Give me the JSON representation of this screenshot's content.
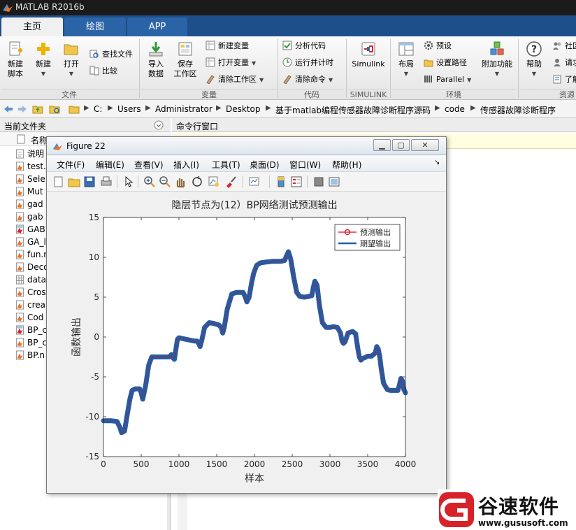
{
  "window": {
    "title": "MATLAB R2016b"
  },
  "ribbon": {
    "tabs": [
      {
        "label": "主页"
      },
      {
        "label": "绘图"
      },
      {
        "label": "APP"
      }
    ],
    "file": {
      "new_script": "新建\n脚本",
      "new": "新建",
      "open": "打开",
      "find_files": "查找文件",
      "compare": "比较",
      "group": "文件"
    },
    "variable": {
      "import_data": "导入\n数据",
      "save_workspace": "保存\n工作区",
      "new_variable": "新建变量",
      "open_variable": "打开变量",
      "clear_workspace": "清除工作区",
      "group": "变量"
    },
    "code": {
      "analyze_code": "分析代码",
      "run_and_time": "运行并计时",
      "clear_commands": "清除命令",
      "group": "代码"
    },
    "simulink": {
      "simulink": "Simulink",
      "group": "SIMULINK"
    },
    "environment": {
      "layout": "布局",
      "preferences": "预设",
      "set_path": "设置路径",
      "parallel": "Parallel",
      "add_ons": "附加功能",
      "group": "环境"
    },
    "resources": {
      "help": "帮助",
      "community": "社区",
      "request_support": "请求",
      "learn": "了解",
      "group": "资源"
    }
  },
  "address": {
    "crumbs": [
      "C:",
      "Users",
      "Administrator",
      "Desktop",
      "基于matlab编程传感器故障诊断程序源码",
      "code",
      "传感器故障诊断程序"
    ]
  },
  "current_folder": {
    "title": "当前文件夹",
    "col_name": "名称",
    "files": [
      {
        "name": "说明",
        "icon": "text-file-icon"
      },
      {
        "name": "test.",
        "icon": "m-file-icon"
      },
      {
        "name": "Sele",
        "icon": "m-file-icon"
      },
      {
        "name": "Mut",
        "icon": "m-file-icon"
      },
      {
        "name": "gad",
        "icon": "m-file-icon"
      },
      {
        "name": "gab",
        "icon": "m-file-icon"
      },
      {
        "name": "GAB",
        "icon": "fig-file-icon"
      },
      {
        "name": "GA_l",
        "icon": "m-file-icon"
      },
      {
        "name": "fun.r",
        "icon": "m-file-icon"
      },
      {
        "name": "Deco",
        "icon": "m-file-icon"
      },
      {
        "name": "data",
        "icon": "mat-file-icon"
      },
      {
        "name": "Cros",
        "icon": "m-file-icon"
      },
      {
        "name": "crea",
        "icon": "m-file-icon"
      },
      {
        "name": "Cod",
        "icon": "m-file-icon"
      },
      {
        "name": "BP_c",
        "icon": "fig-file-icon"
      },
      {
        "name": "BP_c",
        "icon": "m-file-icon"
      },
      {
        "name": "BP.n",
        "icon": "m-file-icon"
      }
    ]
  },
  "command_window": {
    "title": "命令行窗口"
  },
  "figure": {
    "title": "Figure 22",
    "menu": [
      "文件(F)",
      "编辑(E)",
      "查看(V)",
      "插入(I)",
      "工具(T)",
      "桌面(D)",
      "窗口(W)",
      "帮助(H)"
    ],
    "toolbar_icons": [
      "new-figure-icon",
      "open-file-icon",
      "save-icon",
      "print-icon",
      "edit-plot-icon",
      "zoom-in-icon",
      "zoom-out-icon",
      "pan-icon",
      "rotate-icon",
      "data-cursor-icon",
      "brush-icon",
      "link-plot-icon",
      "colorbar-icon",
      "legend-icon",
      "hide-plot-tools-icon",
      "show-plot-tools-icon"
    ]
  },
  "chart_data": {
    "type": "line",
    "title": "隐层节点为(12）BP网络测试预测输出",
    "xlabel": "样本",
    "ylabel": "函数输出",
    "xlim": [
      0,
      4000
    ],
    "ylim": [
      -15,
      15
    ],
    "xticks": [
      0,
      500,
      1000,
      1500,
      2000,
      2500,
      3000,
      3500,
      4000
    ],
    "yticks": [
      -15,
      -10,
      -5,
      0,
      5,
      10,
      15
    ],
    "grid": false,
    "legend_position": "top-right",
    "series": [
      {
        "name": "预测输出",
        "color": "#e8001c",
        "style": "line-with-circle-markers"
      },
      {
        "name": "期望输出",
        "color": "#1f5fa8",
        "style": "solid-line"
      }
    ],
    "x": [
      0,
      100,
      180,
      220,
      240,
      280,
      310,
      350,
      380,
      420,
      460,
      480,
      500,
      520,
      560,
      600,
      640,
      700,
      800,
      870,
      900,
      920,
      940,
      960,
      980,
      1000,
      1100,
      1200,
      1240,
      1260,
      1280,
      1300,
      1340,
      1400,
      1460,
      1500,
      1530,
      1560,
      1580,
      1600,
      1640,
      1700,
      1760,
      1800,
      1850,
      1880,
      1900,
      1930,
      1960,
      1990,
      2030,
      2080,
      2150,
      2250,
      2350,
      2400,
      2430,
      2450,
      2480,
      2520,
      2560,
      2600,
      2660,
      2720,
      2760,
      2780,
      2800,
      2830,
      2860,
      2900,
      2950,
      3000,
      3050,
      3100,
      3140,
      3160,
      3180,
      3200,
      3240,
      3300,
      3340,
      3370,
      3390,
      3410,
      3430,
      3460,
      3500,
      3550,
      3600,
      3620,
      3640,
      3660,
      3680,
      3710,
      3760,
      3800,
      3850,
      3900,
      3920,
      3940,
      3960,
      3980,
      4000
    ],
    "y": [
      -10.5,
      -10.5,
      -10.6,
      -11.4,
      -12.0,
      -11.8,
      -10.0,
      -7.8,
      -6.7,
      -6.5,
      -6.5,
      -6.5,
      -7.0,
      -7.8,
      -6.0,
      -3.5,
      -2.5,
      -2.5,
      -2.5,
      -2.5,
      -2.2,
      -2.6,
      -2.8,
      -1.5,
      -0.3,
      -0.1,
      -0.3,
      -0.5,
      -0.5,
      -0.8,
      -1.2,
      -0.5,
      1.2,
      1.8,
      1.7,
      1.6,
      1.5,
      1.2,
      0.5,
      1.2,
      3.5,
      5.4,
      5.6,
      5.6,
      5.6,
      5.0,
      4.4,
      5.0,
      6.7,
      8.0,
      9.0,
      9.3,
      9.4,
      9.5,
      9.5,
      9.6,
      10.3,
      10.7,
      9.8,
      7.5,
      5.6,
      5.1,
      5.0,
      5.1,
      5.2,
      6.2,
      7.0,
      6.5,
      4.0,
      1.8,
      1.2,
      1.2,
      1.3,
      1.2,
      0.5,
      -0.5,
      -0.8,
      -0.6,
      0.5,
      0.7,
      0.4,
      -1.5,
      -2.5,
      -2.9,
      -2.7,
      -2.6,
      -2.4,
      -2.4,
      -2.0,
      -1.2,
      -1.5,
      -2.5,
      -4.0,
      -5.8,
      -6.6,
      -6.7,
      -6.7,
      -6.7,
      -6.0,
      -5.2,
      -5.5,
      -6.6,
      -7.0
    ]
  },
  "watermark": {
    "name": "谷速软件",
    "url": "www.gususoft.com",
    "logo_letter": "G",
    "color": "#d8222a"
  }
}
